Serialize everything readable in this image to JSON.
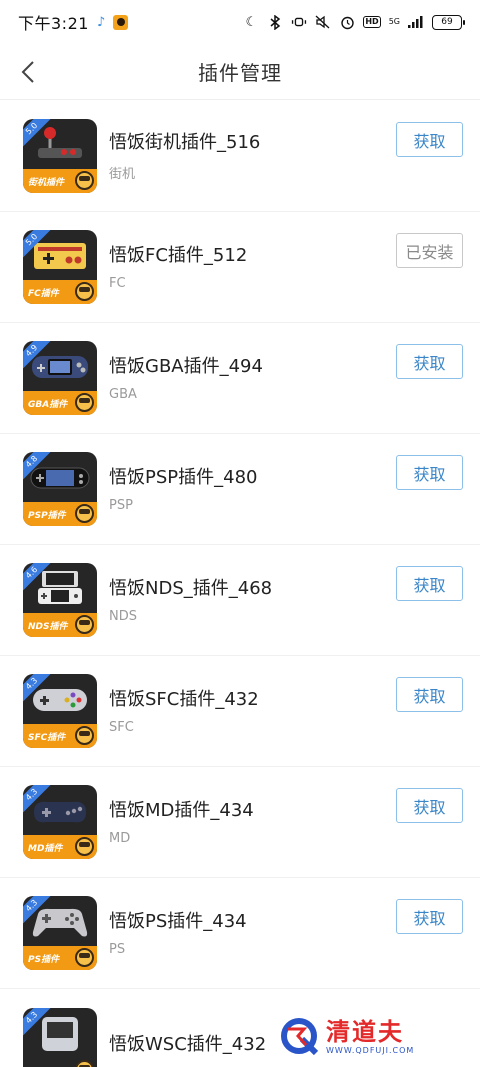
{
  "status_bar": {
    "time": "下午3:21",
    "network": "5G",
    "battery": "69",
    "hd": "HD"
  },
  "header": {
    "title": "插件管理"
  },
  "plugins": [
    {
      "name": "悟饭街机插件_516",
      "platform": "街机",
      "badge": "街机插件",
      "version": "5.0",
      "action": "获取",
      "installed": false,
      "screen_color": "#2b2b2b",
      "device": "arcade"
    },
    {
      "name": "悟饭FC插件_512",
      "platform": "FC",
      "badge": "FC插件",
      "version": "5.0",
      "action": "已安装",
      "installed": true,
      "screen_color": "#2b2b2b",
      "device": "fc"
    },
    {
      "name": "悟饭GBA插件_494",
      "platform": "GBA",
      "badge": "GBA插件",
      "version": "4.9",
      "action": "获取",
      "installed": false,
      "screen_color": "#2b2b2b",
      "device": "gba"
    },
    {
      "name": "悟饭PSP插件_480",
      "platform": "PSP",
      "badge": "PSP插件",
      "version": "4.8",
      "action": "获取",
      "installed": false,
      "screen_color": "#2b2b2b",
      "device": "psp"
    },
    {
      "name": "悟饭NDS_插件_468",
      "platform": "NDS",
      "badge": "NDS插件",
      "version": "4.6",
      "action": "获取",
      "installed": false,
      "screen_color": "#2b2b2b",
      "device": "nds"
    },
    {
      "name": "悟饭SFC插件_432",
      "platform": "SFC",
      "badge": "SFC插件",
      "version": "4.3",
      "action": "获取",
      "installed": false,
      "screen_color": "#2b2b2b",
      "device": "sfc"
    },
    {
      "name": "悟饭MD插件_434",
      "platform": "MD",
      "badge": "MD插件",
      "version": "4.3",
      "action": "获取",
      "installed": false,
      "screen_color": "#2b2b2b",
      "device": "md"
    },
    {
      "name": "悟饭PS插件_434",
      "platform": "PS",
      "badge": "PS插件",
      "version": "4.3",
      "action": "获取",
      "installed": false,
      "screen_color": "#2b2b2b",
      "device": "ps"
    },
    {
      "name": "悟饭WSC插件_432",
      "platform": "",
      "badge": "",
      "version": "4.3",
      "action": "",
      "installed": false,
      "screen_color": "#2b2b2b",
      "device": "wsc"
    }
  ],
  "watermark": {
    "brand": "清道夫",
    "url": "WWW.QDFUJI.COM"
  },
  "colors": {
    "accent_blue": "#3a86c8",
    "badge_orange": "#f39a14",
    "version_blue": "#3a7be0"
  }
}
